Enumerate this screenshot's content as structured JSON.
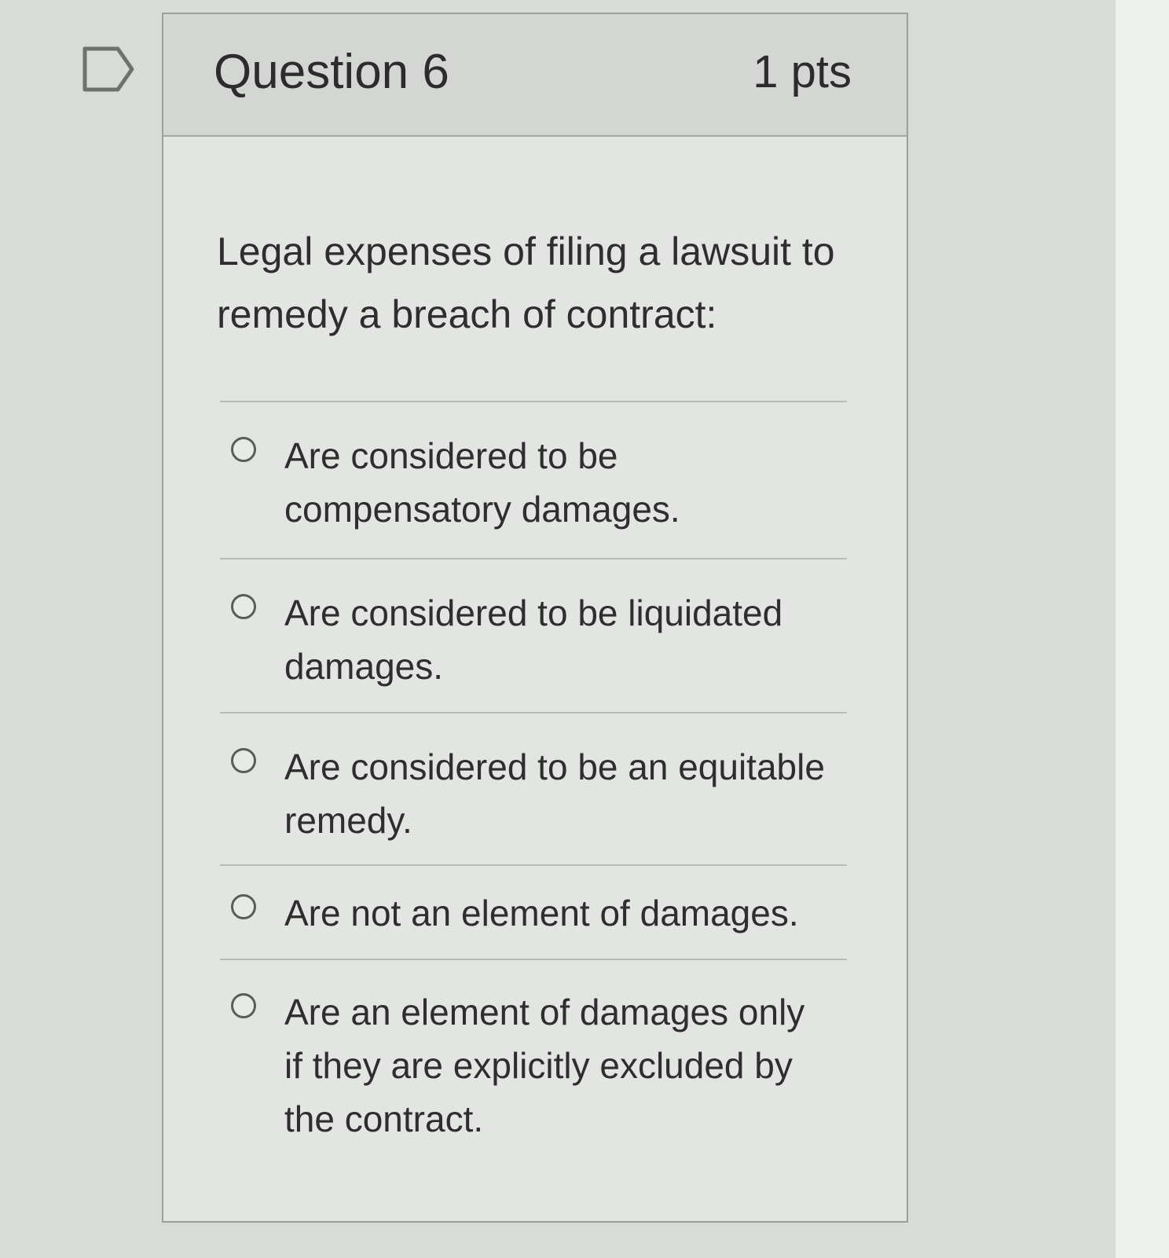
{
  "question": {
    "title": "Question 6",
    "points": "1 pts",
    "text": "Legal expenses of filing a lawsuit to remedy a breach of contract:"
  },
  "answers": [
    {
      "label": "Are considered to be compensatory damages.",
      "selected": false
    },
    {
      "label": "Are  considered to be liquidated damages.",
      "selected": false
    },
    {
      "label": "Are considered to be an equitable remedy.",
      "selected": false
    },
    {
      "label": "Are not an element of damages.",
      "selected": false
    },
    {
      "label": "Are an element of damages only if they are explicitly excluded by the contract.",
      "selected": false
    }
  ],
  "icons": {
    "flag": "flag-question-icon",
    "radio": "radio-button-icon"
  },
  "colors": {
    "background": "#d9dbd8",
    "card": "#e3e5e2",
    "header": "#d4d6d3",
    "text": "#2b2c2b"
  }
}
